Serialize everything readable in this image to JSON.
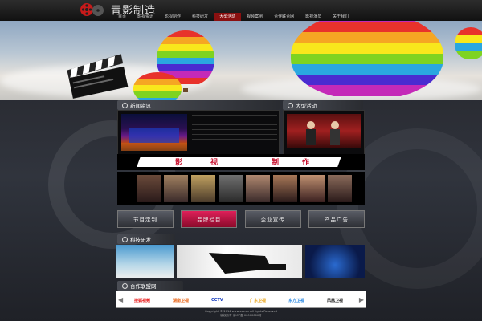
{
  "header": {
    "logo_title": "青影制造",
    "nav": [
      "首页",
      "影视资讯",
      "影视制作",
      "科技研发",
      "大型活动",
      "视频案例",
      "合作联合网",
      "影视演员",
      "关于我们"
    ],
    "active_nav_index": 4
  },
  "sections": {
    "news_title": "新闻资讯",
    "event_title": "大型活动",
    "tech_title": "科技研发",
    "partners_title": "合作联盟网"
  },
  "film": {
    "chars": [
      "影",
      "视",
      "制",
      "作"
    ]
  },
  "categories": [
    "节目定制",
    "品牌栏目",
    "企业宣传",
    "产品广告"
  ],
  "active_category_index": 1,
  "partners": [
    "搜狐视频",
    "湖南卫视",
    "CCTV",
    "广东卫视",
    "东方卫视",
    "凤凰卫视"
  ],
  "footer": {
    "line1": "Copyright © 2014 www.xxx.cn All rights Reserved",
    "line2": "版权所有 京ICP备 00000000号"
  },
  "colors": {
    "accent": "#c8102e",
    "nav_active": "#8a1010"
  }
}
